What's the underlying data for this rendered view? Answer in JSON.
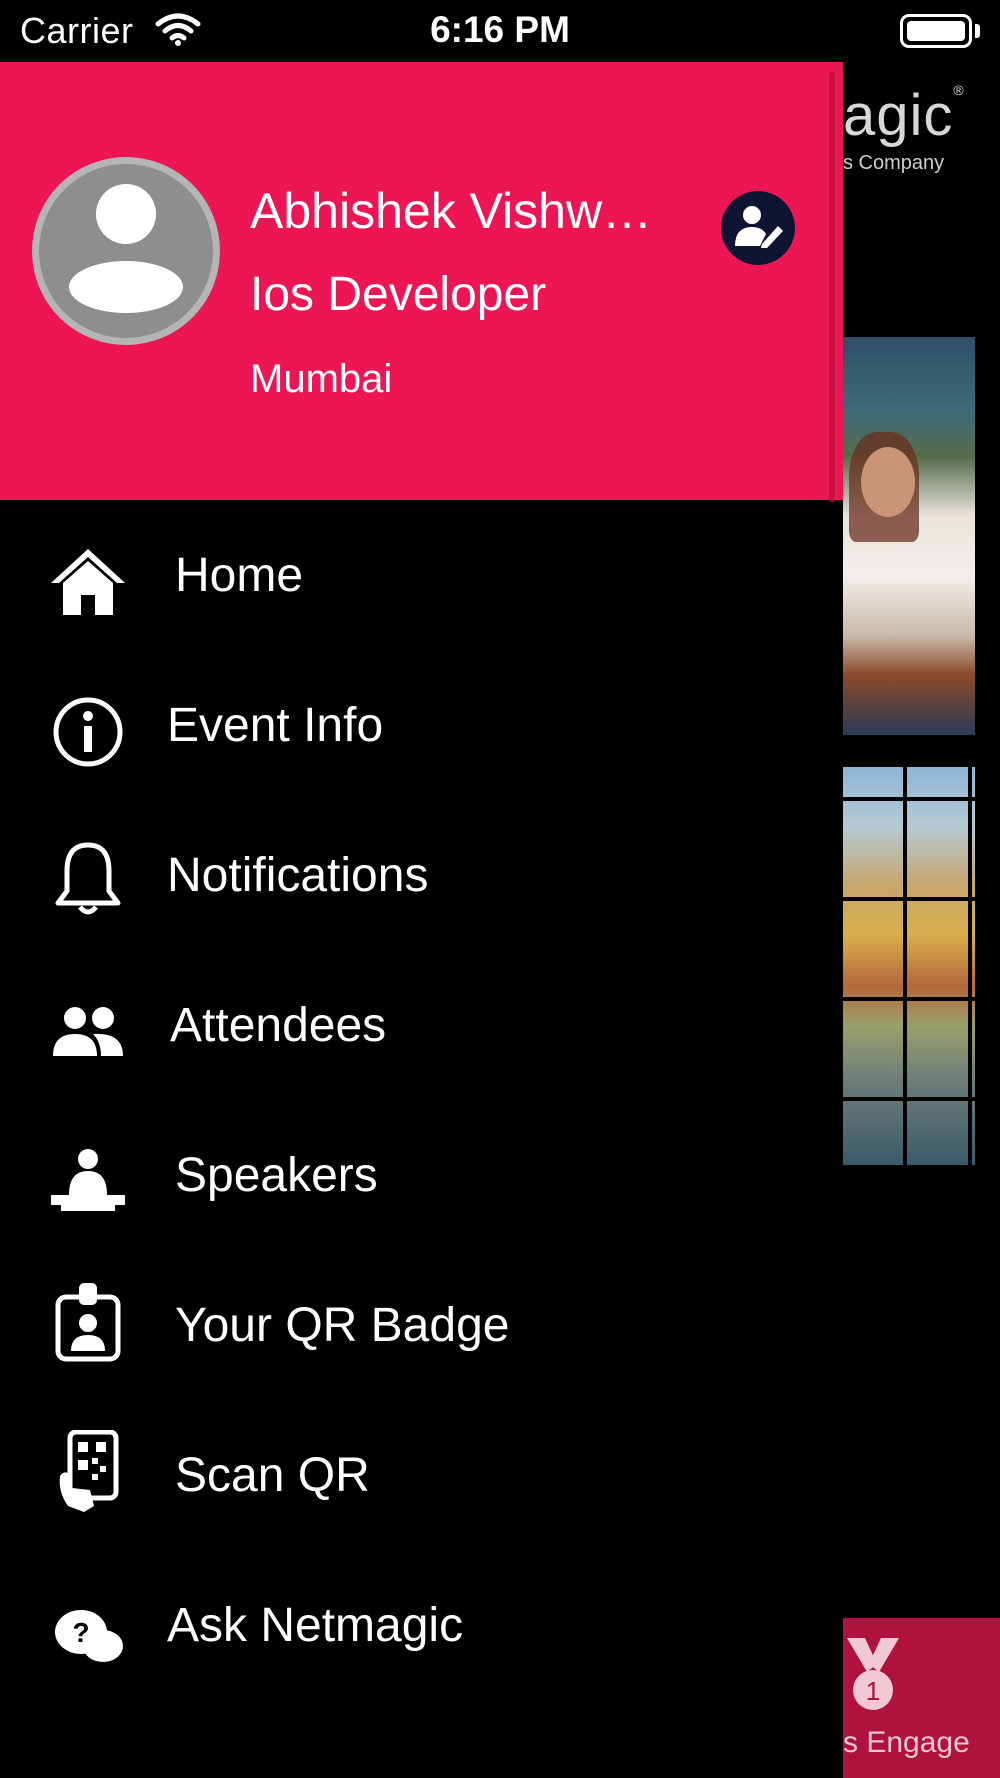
{
  "status_bar": {
    "carrier": "Carrier",
    "time": "6:16 PM"
  },
  "profile": {
    "name": "Abhishek Vishw…",
    "role": "Ios Developer",
    "city": "Mumbai"
  },
  "menu": {
    "items": [
      {
        "label": "Home",
        "icon": "home-icon"
      },
      {
        "label": "Event Info",
        "icon": "info-icon"
      },
      {
        "label": "Notifications",
        "icon": "bell-icon"
      },
      {
        "label": "Attendees",
        "icon": "people-icon"
      },
      {
        "label": "Speakers",
        "icon": "speaker-podium-icon"
      },
      {
        "label": "Your QR Badge",
        "icon": "badge-icon"
      },
      {
        "label": "Scan QR",
        "icon": "scan-qr-icon"
      },
      {
        "label": "Ask Netmagic",
        "icon": "ask-chat-icon"
      }
    ]
  },
  "background_app": {
    "logo_fragment": "agic",
    "registered_mark": "®",
    "tagline_fragment": "s Company",
    "engage_label": "s Engage",
    "medal_number": "1"
  },
  "colors": {
    "header_pink": "#ec1655",
    "drawer_bg": "#000000",
    "edit_button_navy": "#101433",
    "engage_banner": "#b0123f"
  }
}
